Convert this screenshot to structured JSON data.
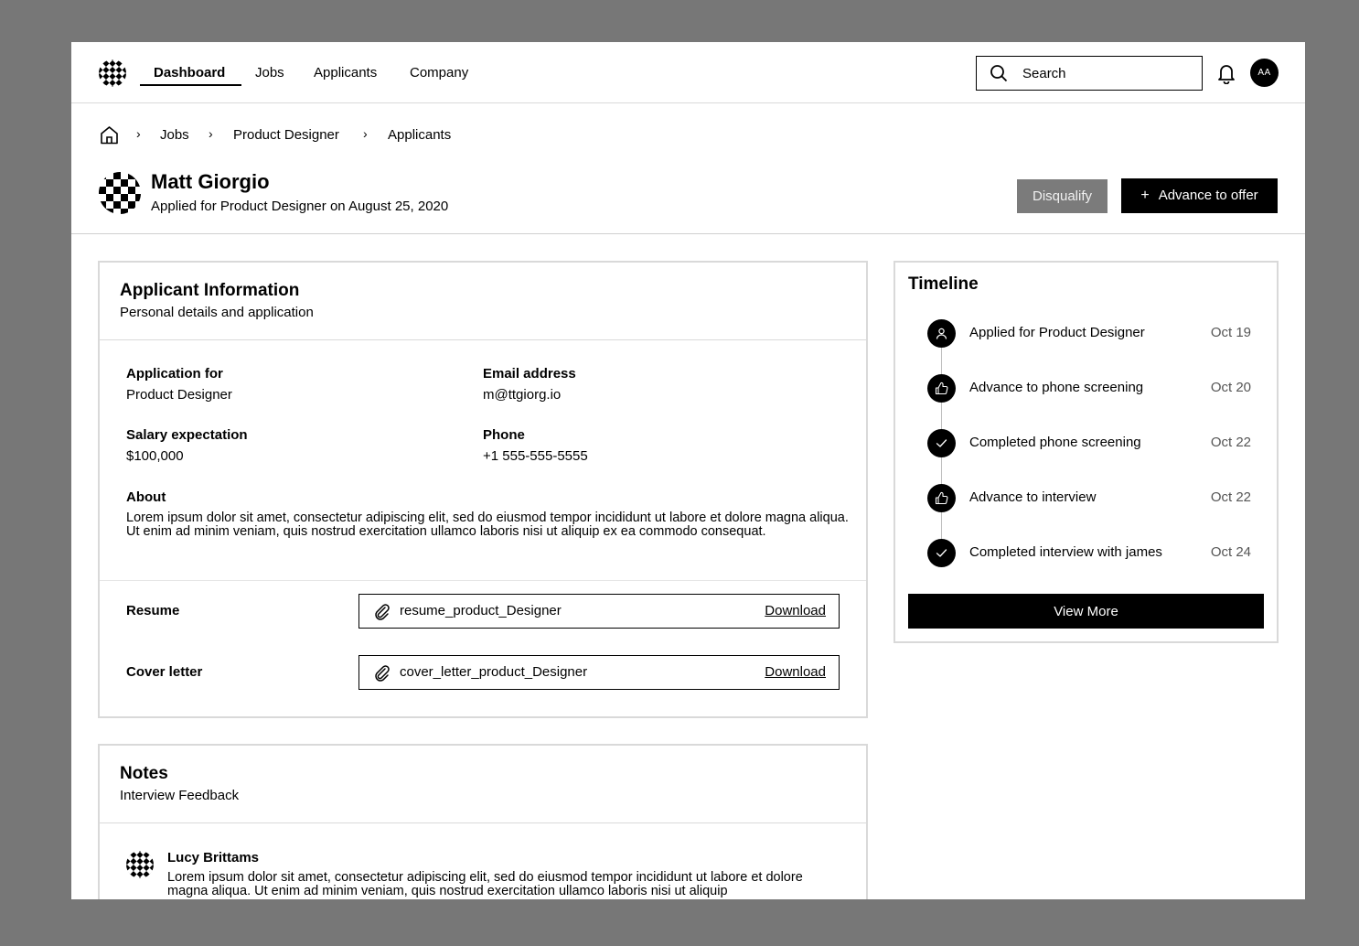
{
  "nav": {
    "items": [
      {
        "label": "Dashboard",
        "active": true
      },
      {
        "label": "Jobs",
        "active": false
      },
      {
        "label": "Applicants",
        "active": false
      },
      {
        "label": "Company",
        "active": false
      }
    ],
    "search_placeholder": "Search",
    "avatar_initials": "AA"
  },
  "breadcrumb": [
    "Jobs",
    "Product Designer",
    "Applicants"
  ],
  "header": {
    "name": "Matt Giorgio",
    "subtitle": "Applied for Product Designer on August 25, 2020",
    "disqualify_label": "Disqualify",
    "advance_label": "Advance to offer"
  },
  "applicant": {
    "title": "Applicant Information",
    "subtitle": "Personal details and application",
    "fields": {
      "application_for": {
        "label": "Application for",
        "value": "Product Designer"
      },
      "email": {
        "label": "Email address",
        "value": "m@ttgiorg.io"
      },
      "salary": {
        "label": "Salary expectation",
        "value": "$100,000"
      },
      "phone": {
        "label": "Phone",
        "value": "+1 555-555-5555"
      }
    },
    "about_label": "About",
    "about_text": "Lorem ipsum dolor sit amet, consectetur adipiscing elit, sed do eiusmod tempor incididunt ut labore et dolore magna aliqua. Ut enim ad minim veniam, quis nostrud exercitation ullamco laboris nisi ut aliquip ex ea commodo consequat.",
    "resume": {
      "label": "Resume",
      "file": "resume_product_Designer",
      "action": "Download"
    },
    "cover": {
      "label": "Cover letter",
      "file": "cover_letter_product_Designer",
      "action": "Download"
    }
  },
  "timeline": {
    "title": "Timeline",
    "events": [
      {
        "icon": "user-icon",
        "text": "Applied for Product Designer",
        "date": "Oct 19"
      },
      {
        "icon": "thumbs-up-icon",
        "text": "Advance to phone screening",
        "date": "Oct 20"
      },
      {
        "icon": "check-icon",
        "text": "Completed phone screening",
        "date": "Oct 22"
      },
      {
        "icon": "thumbs-up-icon",
        "text": "Advance to interview",
        "date": "Oct 22"
      },
      {
        "icon": "check-icon",
        "text": "Completed interview with james",
        "date": "Oct 24"
      }
    ],
    "more_label": "View More"
  },
  "notes": {
    "title": "Notes",
    "subtitle": "Interview Feedback",
    "author": "Lucy Brittams",
    "text": "Lorem ipsum dolor sit amet, consectetur adipiscing elit, sed do eiusmod tempor incididunt ut labore et dolore magna aliqua. Ut enim ad minim veniam, quis nostrud exercitation ullamco laboris nisi ut aliquip"
  }
}
